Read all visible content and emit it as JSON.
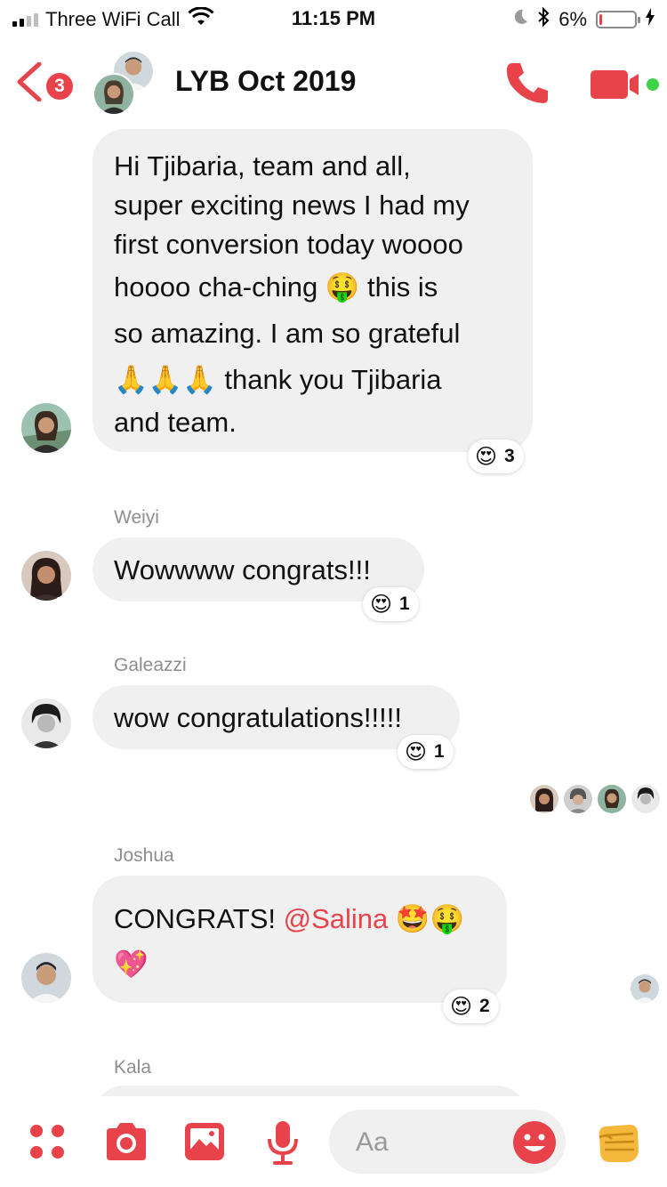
{
  "status_bar": {
    "carrier": "Three WiFi Call",
    "time": "11:15 PM",
    "battery_percent": "6%",
    "battery_level": 0.06,
    "icons": [
      "signal-icon",
      "wifi-icon",
      "moon-icon",
      "bluetooth-icon",
      "battery-icon",
      "charging-bolt-icon"
    ]
  },
  "header": {
    "back_badge": "3",
    "title": "LYB Oct 2019",
    "icons": [
      "back-chevron-icon",
      "phone-icon",
      "video-camera-icon",
      "active-dot-icon"
    ]
  },
  "messages": [
    {
      "sender": "",
      "lines": [
        "Hi Tjibaria, team and all,",
        "super exciting news I had my",
        "first conversion today woooo",
        "hoooo cha-ching 🤑 this is",
        "so amazing.   I am so grateful",
        "🙏🙏🙏 thank you Tjibaria",
        "and team."
      ],
      "reaction_emoji": "😍",
      "reaction_count": "3"
    },
    {
      "sender": "Weiyi",
      "text": "Wowwww congrats!!!",
      "reaction_emoji": "😍",
      "reaction_count": "1"
    },
    {
      "sender": "Galeazzi",
      "text": "wow congratulations!!!!!",
      "reaction_emoji": "😍",
      "reaction_count": "1"
    },
    {
      "sender": "Joshua",
      "text_prefix": "CONGRATS! ",
      "mention": "@Salina",
      "text_emojis": " 🤩🤑",
      "text_line2": "💖",
      "reaction_emoji": "😍",
      "reaction_count": "2"
    },
    {
      "sender": "Kala"
    }
  ],
  "composer": {
    "placeholder": "Aa",
    "icons": [
      "apps-grid-icon",
      "camera-icon",
      "gallery-icon",
      "microphone-icon",
      "emoji-smiley-icon",
      "fist-bump-icon"
    ]
  },
  "colors": {
    "accent": "#e8424a",
    "bubble": "#f0f0f0",
    "meta_text": "#8e8e8e"
  }
}
